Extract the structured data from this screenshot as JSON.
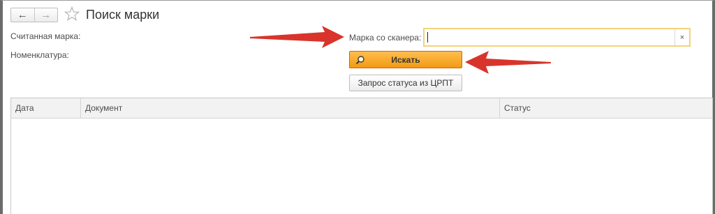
{
  "window": {
    "title": "Поиск марки"
  },
  "nav": {
    "back_icon": "←",
    "forward_icon": "→"
  },
  "fields": {
    "scanned_mark_label": "Считанная марка:",
    "nomenclature_label": "Номенклатура:",
    "scanner_label": "Марка со сканера:",
    "scanner_value": "",
    "clear_icon": "×"
  },
  "buttons": {
    "search_label": "Искать",
    "status_request_label": "Запрос статуса из ЦРПТ"
  },
  "table": {
    "columns": [
      "Дата",
      "Документ",
      "Статус"
    ],
    "rows": []
  },
  "colors": {
    "accent_button": "#f5a623",
    "input_focus_border": "#f3d27a",
    "annotation_arrow": "#d9342b"
  }
}
